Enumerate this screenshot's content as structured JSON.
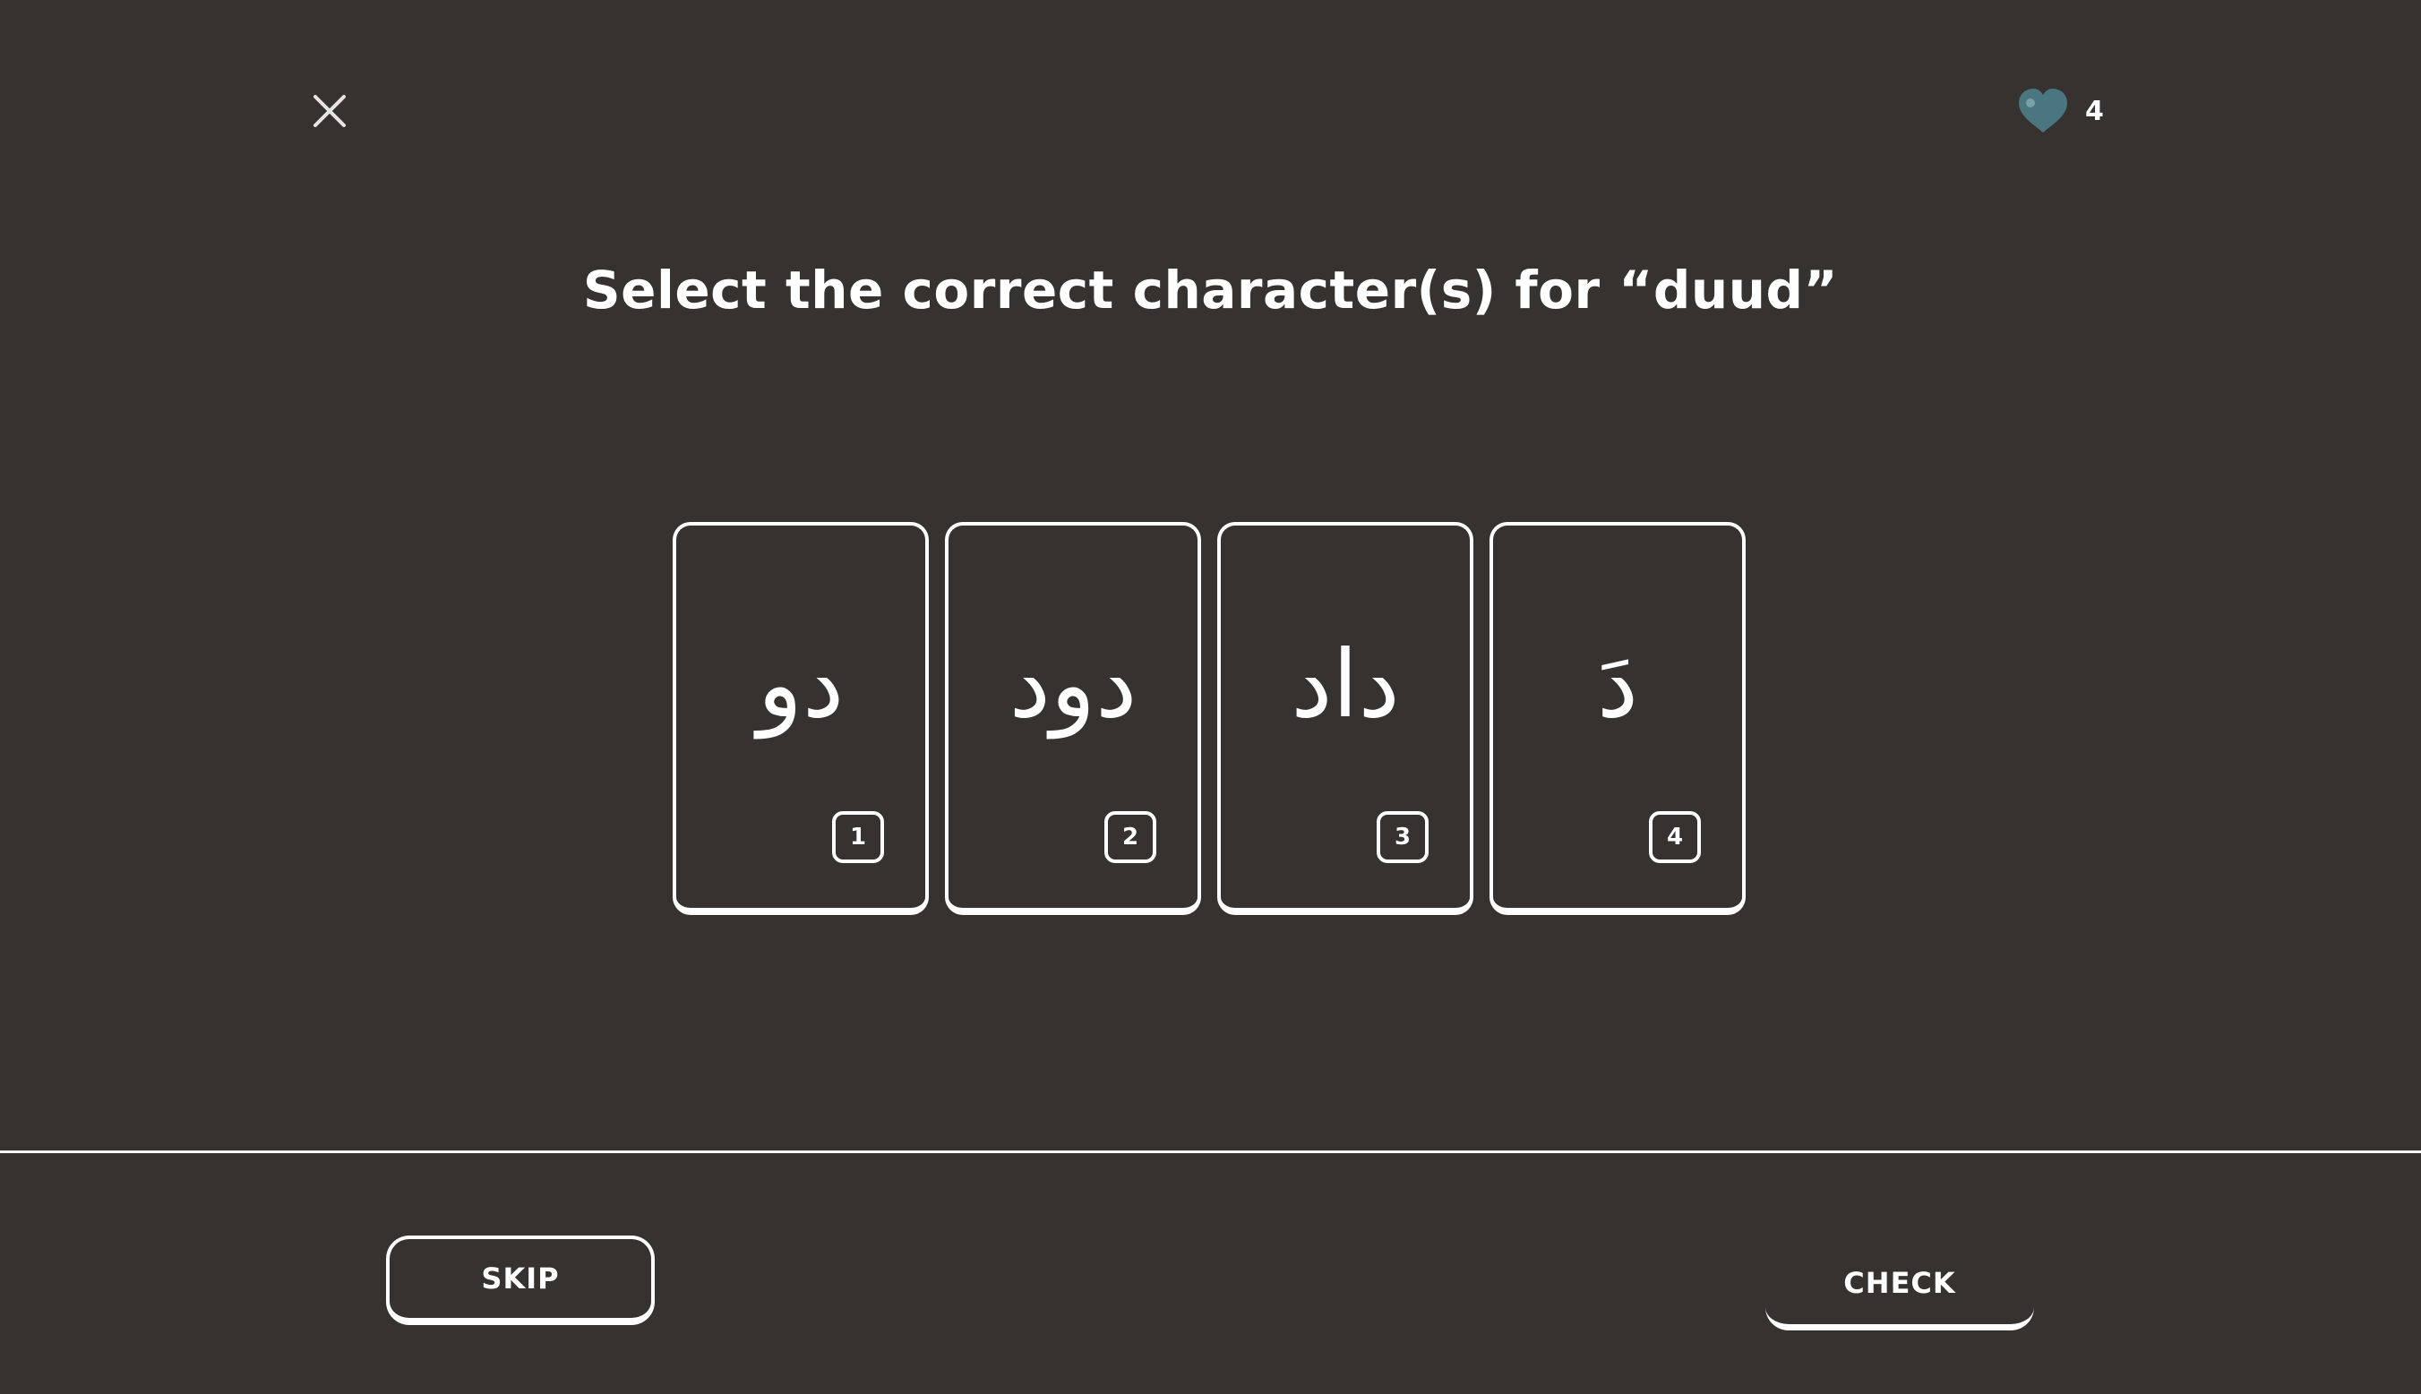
{
  "header": {
    "close_icon": "close-icon",
    "hearts": {
      "icon": "heart-icon",
      "icon_color": "#4a7680",
      "count": "4"
    }
  },
  "prompt": {
    "text": "Select the correct character(s) for “duud”"
  },
  "choices": [
    {
      "glyph": "دو",
      "key": "1"
    },
    {
      "glyph": "دود",
      "key": "2"
    },
    {
      "glyph": "داد",
      "key": "3"
    },
    {
      "glyph": "دَ",
      "key": "4"
    }
  ],
  "footer": {
    "skip_label": "SKIP",
    "check_label": "CHECK"
  },
  "colors": {
    "background": "#353230",
    "foreground": "#ffffff",
    "heart": "#4a7680"
  }
}
